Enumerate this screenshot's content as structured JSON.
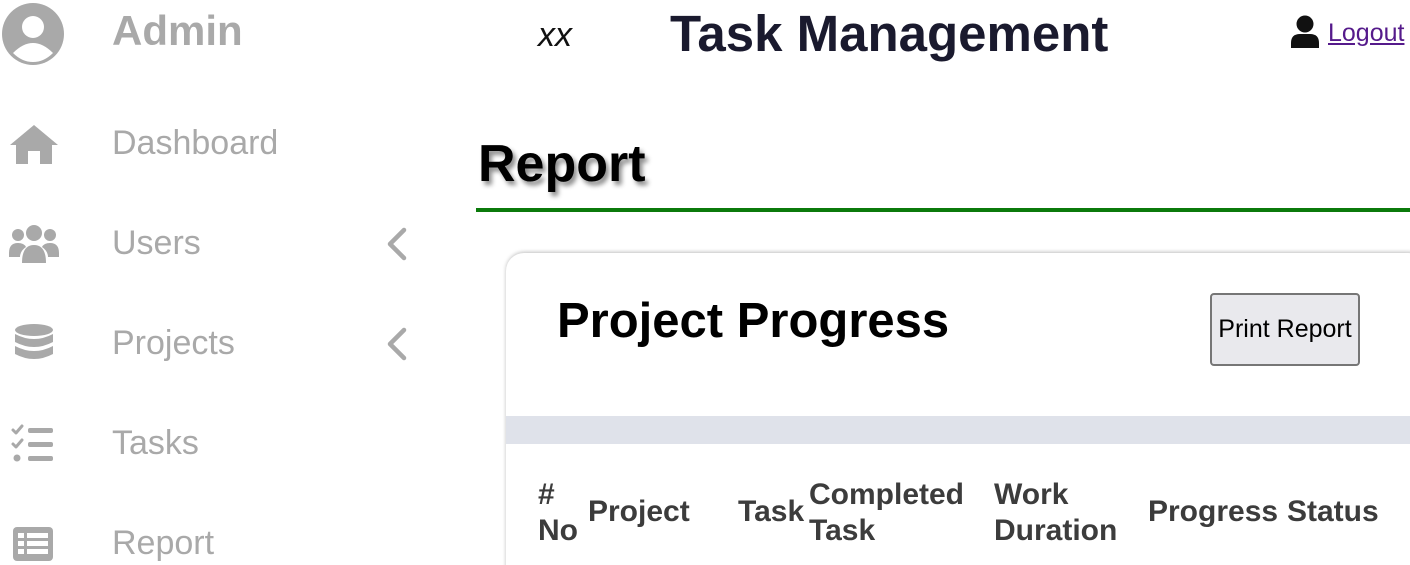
{
  "sidebar": {
    "brand": "Admin",
    "avatar_icon": "user-circle-icon",
    "items": [
      {
        "label": "Dashboard",
        "icon": "home-icon",
        "has_submenu": false
      },
      {
        "label": "Users",
        "icon": "users-icon",
        "has_submenu": true
      },
      {
        "label": "Projects",
        "icon": "database-icon",
        "has_submenu": true
      },
      {
        "label": "Tasks",
        "icon": "tasks-checklist-icon",
        "has_submenu": false
      },
      {
        "label": "Report",
        "icon": "report-table-icon",
        "has_submenu": false
      }
    ]
  },
  "header": {
    "mark": "xx",
    "title": "Task Management",
    "user_icon": "user-icon",
    "logout_label": "Logout"
  },
  "page": {
    "title": "Report",
    "accent_color": "#0b7a0b"
  },
  "card": {
    "title": "Project Progress",
    "print_label": "Print Report",
    "table": {
      "columns": [
        {
          "lines": [
            "#",
            "No"
          ]
        },
        {
          "lines": [
            "Project"
          ]
        },
        {
          "lines": [
            "Task"
          ]
        },
        {
          "lines": [
            "Completed",
            "Task"
          ]
        },
        {
          "lines": [
            "Work",
            "Duration"
          ]
        },
        {
          "lines": [
            "Progress"
          ]
        },
        {
          "lines": [
            "Status"
          ]
        }
      ]
    }
  },
  "colors": {
    "sidebar_text": "#a9a9a9",
    "title_text": "#1a1a2e",
    "link": "#551a8b",
    "band": "#dfe2ea"
  }
}
